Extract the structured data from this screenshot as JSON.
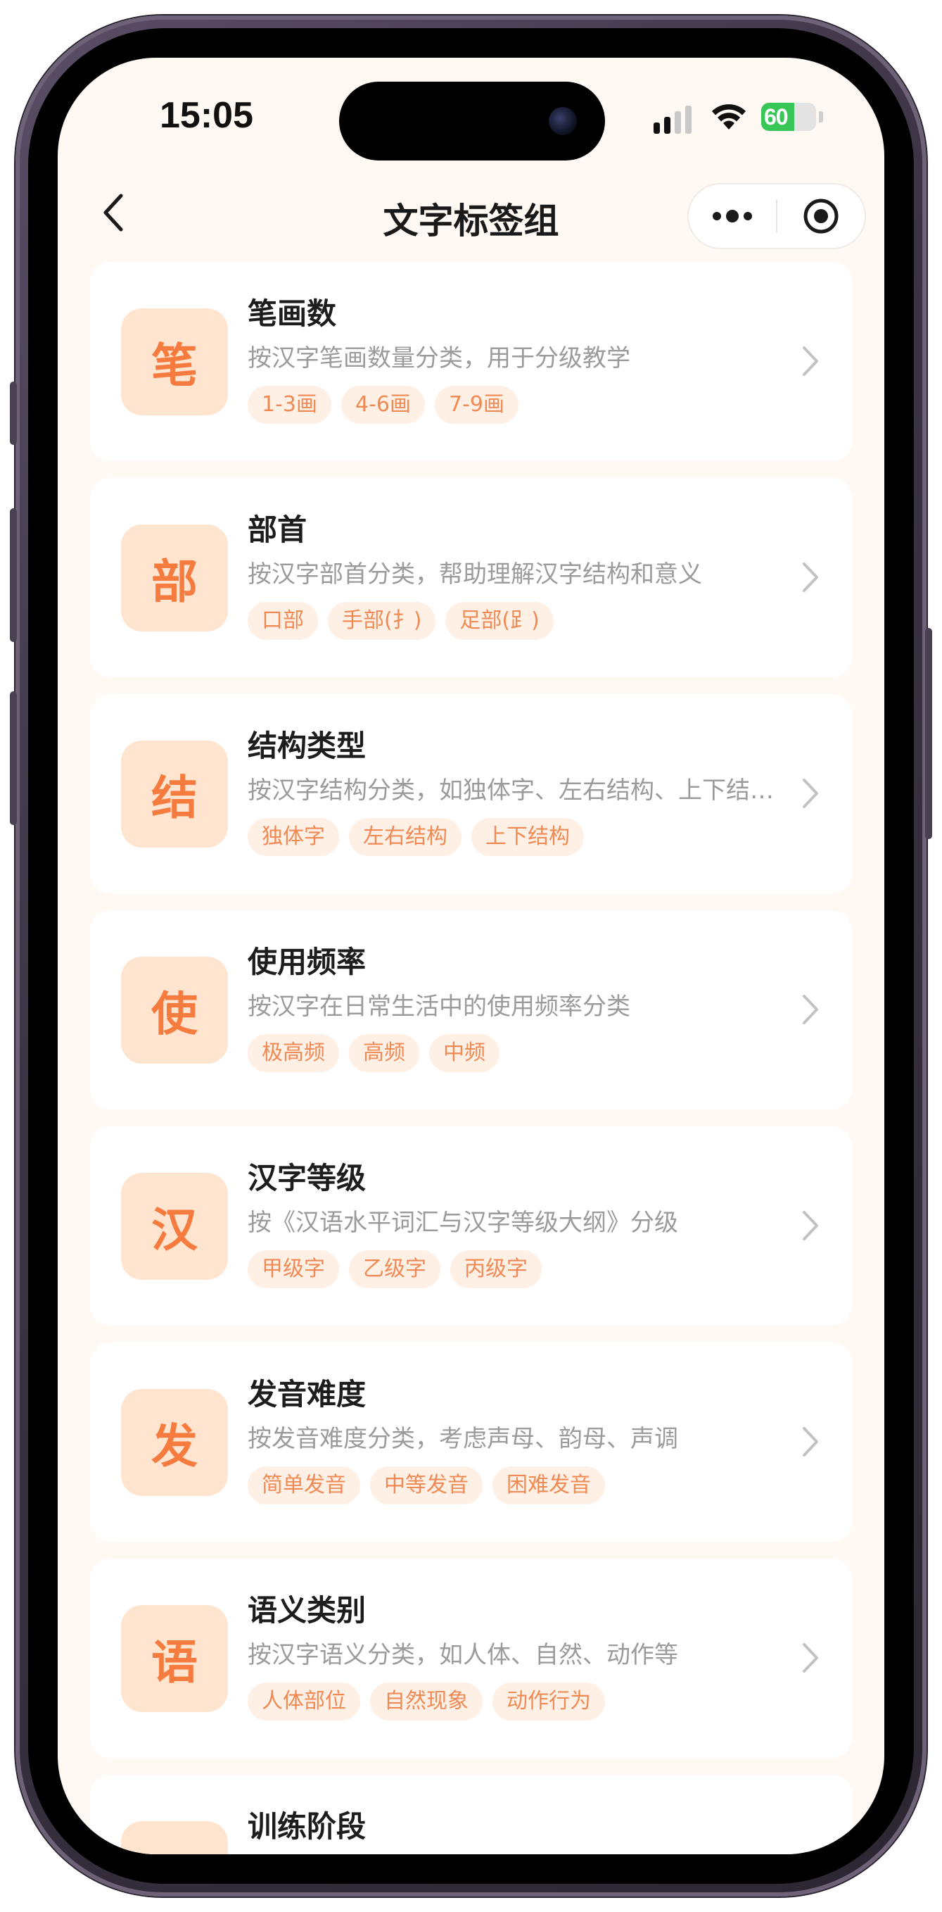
{
  "status_bar": {
    "time": "15:05",
    "battery_text": "60",
    "battery_level": 0.6
  },
  "nav": {
    "title": "文字标签组",
    "back_icon": "chevron-left-icon",
    "more_icon": "more-dots-icon",
    "close_icon": "target-circle-icon"
  },
  "colors": {
    "accent": "#f57b3e",
    "icon_bg": "#ffe4d0",
    "tag_bg": "#fff0e6",
    "tag_text": "#f08a55",
    "page_bg": "#fff8f3"
  },
  "groups": [
    {
      "icon": "笔",
      "title": "笔画数",
      "desc": "按汉字笔画数量分类，用于分级教学",
      "tags": [
        "1-3画",
        "4-6画",
        "7-9画"
      ]
    },
    {
      "icon": "部",
      "title": "部首",
      "desc": "按汉字部首分类，帮助理解汉字结构和意义",
      "tags": [
        "口部",
        "手部(扌)",
        "足部(⻊)"
      ]
    },
    {
      "icon": "结",
      "title": "结构类型",
      "desc": "按汉字结构分类，如独体字、左右结构、上下结构等",
      "tags": [
        "独体字",
        "左右结构",
        "上下结构"
      ]
    },
    {
      "icon": "使",
      "title": "使用频率",
      "desc": "按汉字在日常生活中的使用频率分类",
      "tags": [
        "极高频",
        "高频",
        "中频"
      ]
    },
    {
      "icon": "汉",
      "title": "汉字等级",
      "desc": "按《汉语水平词汇与汉字等级大纲》分级",
      "tags": [
        "甲级字",
        "乙级字",
        "丙级字"
      ]
    },
    {
      "icon": "发",
      "title": "发音难度",
      "desc": "按发音难度分类，考虑声母、韵母、声调",
      "tags": [
        "简单发音",
        "中等发音",
        "困难发音"
      ]
    },
    {
      "icon": "语",
      "title": "语义类别",
      "desc": "按汉字语义分类，如人体、自然、动作等",
      "tags": [
        "人体部位",
        "自然现象",
        "动作行为"
      ]
    },
    {
      "icon": "",
      "title": "训练阶段",
      "desc": "",
      "tags": []
    }
  ]
}
